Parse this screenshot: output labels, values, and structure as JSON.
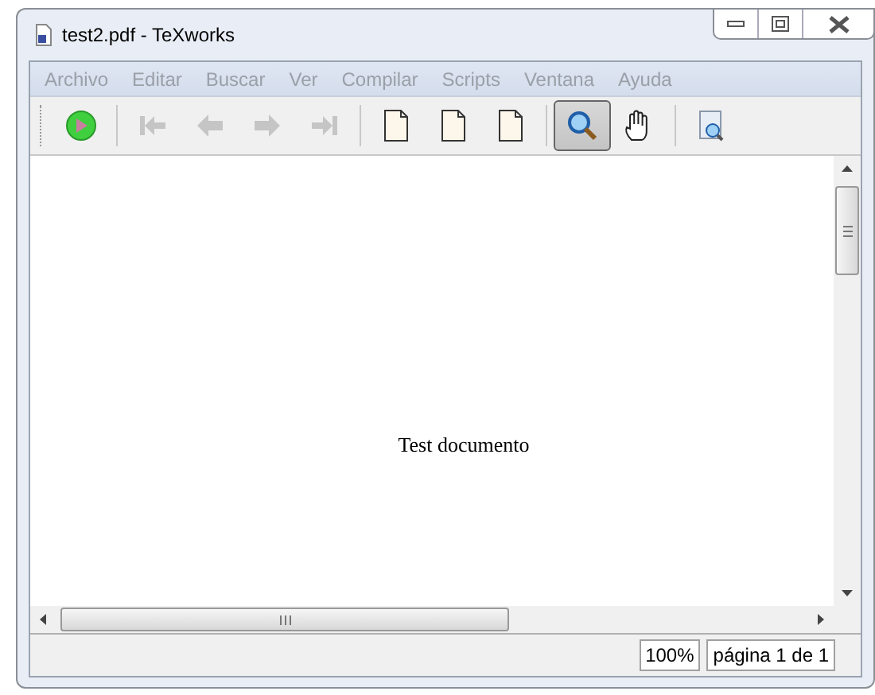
{
  "window": {
    "title": "test2.pdf - TeXworks"
  },
  "menu": [
    "Archivo",
    "Editar",
    "Buscar",
    "Ver",
    "Compilar",
    "Scripts",
    "Ventana",
    "Ayuda"
  ],
  "toolbar_groups": [
    {
      "buttons": [
        {
          "kind": "play",
          "disabled": false,
          "selected": false
        }
      ]
    },
    {
      "buttons": [
        {
          "kind": "first",
          "disabled": true,
          "selected": false
        },
        {
          "kind": "prev",
          "disabled": true,
          "selected": false
        },
        {
          "kind": "next",
          "disabled": true,
          "selected": false
        },
        {
          "kind": "last",
          "disabled": true,
          "selected": false
        }
      ]
    },
    {
      "buttons": [
        {
          "kind": "page",
          "disabled": false,
          "selected": false
        },
        {
          "kind": "page",
          "disabled": false,
          "selected": false
        },
        {
          "kind": "page",
          "disabled": false,
          "selected": false
        }
      ]
    },
    {
      "buttons": [
        {
          "kind": "zoom",
          "disabled": false,
          "selected": true
        },
        {
          "kind": "hand",
          "disabled": false,
          "selected": false
        }
      ]
    },
    {
      "buttons": [
        {
          "kind": "find",
          "disabled": false,
          "selected": false
        }
      ]
    }
  ],
  "document": {
    "text": "Test documento"
  },
  "status_bar": {
    "zoom": "100%",
    "page": "página 1 de 1"
  }
}
